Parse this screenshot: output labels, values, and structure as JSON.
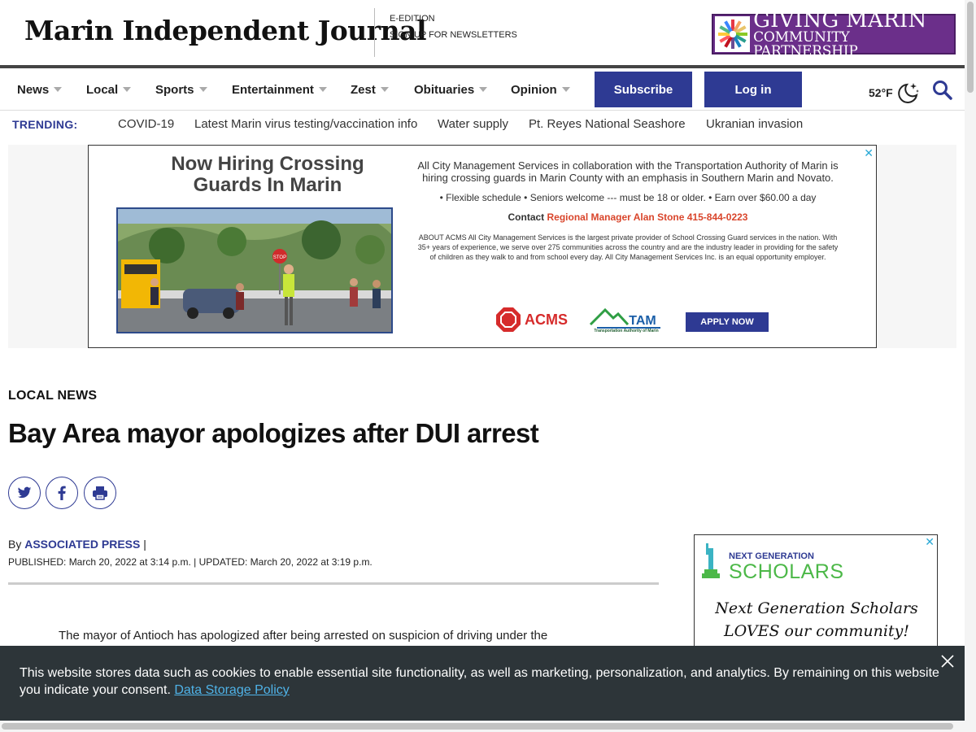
{
  "header": {
    "masthead": "Marin Independent Journal",
    "links": [
      "E-EDITION",
      "SIGN UP FOR NEWSLETTERS"
    ],
    "promo": {
      "line1": "GIVING MARIN",
      "line2": "COMMUNITY PARTNERSHIP"
    }
  },
  "nav": {
    "items": [
      "News",
      "Local",
      "Sports",
      "Entertainment",
      "Zest",
      "Obituaries",
      "Opinion"
    ],
    "subscribe": "Subscribe",
    "login": "Log in",
    "temperature": "52°F",
    "weather_icon": "moon-stars-icon",
    "search_icon": "search-icon"
  },
  "trending": {
    "label": "TRENDING:",
    "links": [
      "COVID-19",
      "Latest Marin virus testing/vaccination info",
      "Water supply",
      "Pt. Reyes National Seashore",
      "Ukranian invasion"
    ]
  },
  "ad": {
    "headline": "Now Hiring Crossing Guards In Marin",
    "intro": "All City Management Services in collaboration with the Transportation Authority of Marin is hiring crossing guards in Marin County with an emphasis in Southern Marin and Novato.",
    "bullets": "• Flexible schedule • Seniors welcome --- must be 18 or older. • Earn over $60.00 a day",
    "contact_prefix": "Contact ",
    "contact_name": "Regional Manager Alan Stone 415-844-0223",
    "about": "ABOUT ACMS All City Management Services is the largest private provider of School Crossing Guard services in the nation. With 35+ years of experience, we serve over 275 communities across the country and are the industry leader in providing for the safety of children as they walk to and from school every day. All City Management Services Inc. is an equal opportunity employer.",
    "acms": "ACMS",
    "tam": "TAM",
    "tam_sub": "Transportation Authority of Marin",
    "apply": "APPLY NOW",
    "close": "✕",
    "sign_text": "STOP"
  },
  "article": {
    "section": "LOCAL NEWS",
    "headline": "Bay Area mayor apologizes after DUI arrest",
    "by": "By ",
    "author": "ASSOCIATED PRESS",
    "by_sep": " |",
    "published": "PUBLISHED: March 20, 2022 at 3:14 p.m. | UPDATED: March 20, 2022 at 3:19 p.m.",
    "body_start": "The mayor of Antioch has apologized after being arrested on suspicion of driving under the"
  },
  "side_ad": {
    "line1": "NEXT GENERATION",
    "line2": "SCHOLARS",
    "script1": "Next Generation Scholars",
    "script2": "LOVES our community!",
    "close": "✕"
  },
  "cookie": {
    "text": "This website stores data such as cookies to enable essential site functionality, as well as marketing, personalization, and analytics. By remaining on this website you indicate your consent. ",
    "link": "Data Storage Policy"
  },
  "colors": {
    "brand_blue": "#2e3a93",
    "promo_purple": "#6b2f8a",
    "cookie_bg": "#2d3539",
    "link_blue": "#4fb3e8",
    "ad_red": "#d9452b"
  }
}
